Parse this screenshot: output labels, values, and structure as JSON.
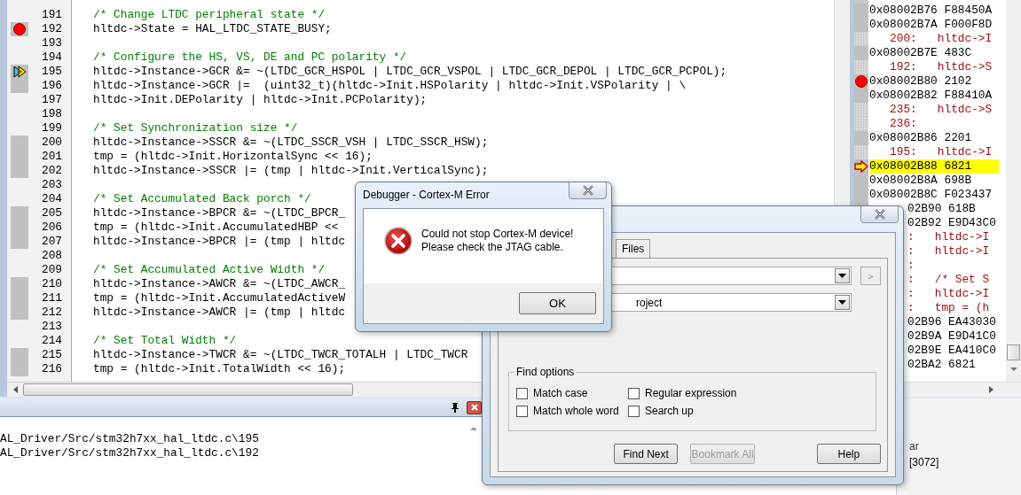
{
  "editor": {
    "lines": [
      {
        "number": "191",
        "text": "/* Change LTDC peripheral state */",
        "kind": "comment",
        "executable": false,
        "breakpoint": false,
        "current": false
      },
      {
        "number": "192",
        "text": "hltdc->State = HAL_LTDC_STATE_BUSY;",
        "kind": "code",
        "executable": true,
        "breakpoint": true,
        "current": false
      },
      {
        "number": "193",
        "kind": "blank",
        "executable": false,
        "breakpoint": false,
        "current": false
      },
      {
        "number": "194",
        "text": "/* Configure the HS, VS, DE and PC polarity */",
        "kind": "comment",
        "executable": false,
        "breakpoint": false,
        "current": false
      },
      {
        "number": "195",
        "text": "hltdc->Instance->GCR &= ~(LTDC_GCR_HSPOL | LTDC_GCR_VSPOL | LTDC_GCR_DEPOL | LTDC_GCR_PCPOL);",
        "kind": "code",
        "executable": true,
        "breakpoint": false,
        "current": true
      },
      {
        "number": "196",
        "text": "hltdc->Instance->GCR |=  (uint32_t)(hltdc->Init.HSPolarity | hltdc->Init.VSPolarity | \\",
        "kind": "code",
        "executable": true,
        "breakpoint": false,
        "current": false
      },
      {
        "number": "197",
        "text": "hltdc->Init.DEPolarity | hltdc->Init.PCPolarity);",
        "kind": "code",
        "executable": false,
        "breakpoint": false,
        "current": false
      },
      {
        "number": "198",
        "kind": "blank",
        "executable": false,
        "breakpoint": false,
        "current": false
      },
      {
        "number": "199",
        "text": "/* Set Synchronization size */",
        "kind": "comment",
        "executable": false,
        "breakpoint": false,
        "current": false
      },
      {
        "number": "200",
        "text": "hltdc->Instance->SSCR &= ~(LTDC_SSCR_VSH | LTDC_SSCR_HSW);",
        "kind": "code",
        "executable": true,
        "breakpoint": false,
        "current": false
      },
      {
        "number": "201",
        "text": "tmp = (hltdc->Init.HorizontalSync << 16);",
        "kind": "code",
        "executable": true,
        "breakpoint": false,
        "current": false
      },
      {
        "number": "202",
        "text": "hltdc->Instance->SSCR |= (tmp | hltdc->Init.VerticalSync);",
        "kind": "code",
        "executable": true,
        "breakpoint": false,
        "current": false
      },
      {
        "number": "203",
        "kind": "blank",
        "executable": false,
        "breakpoint": false,
        "current": false
      },
      {
        "number": "204",
        "text": "/* Set Accumulated Back porch */",
        "kind": "comment",
        "executable": false,
        "breakpoint": false,
        "current": false
      },
      {
        "number": "205",
        "text": "hltdc->Instance->BPCR &= ~(LTDC_BPCR_",
        "kind": "code",
        "executable": true,
        "breakpoint": false,
        "current": false
      },
      {
        "number": "206",
        "text": "tmp = (hltdc->Init.AccumulatedHBP <<",
        "kind": "code",
        "executable": true,
        "breakpoint": false,
        "current": false
      },
      {
        "number": "207",
        "text": "hltdc->Instance->BPCR |= (tmp | hltdc",
        "kind": "code",
        "executable": true,
        "breakpoint": false,
        "current": false
      },
      {
        "number": "208",
        "kind": "blank",
        "executable": false,
        "breakpoint": false,
        "current": false
      },
      {
        "number": "209",
        "text": "/* Set Accumulated Active Width */",
        "kind": "comment",
        "executable": false,
        "breakpoint": false,
        "current": false
      },
      {
        "number": "210",
        "text": "hltdc->Instance->AWCR &= ~(LTDC_AWCR_",
        "kind": "code",
        "executable": true,
        "breakpoint": false,
        "current": false
      },
      {
        "number": "211",
        "text": "tmp = (hltdc->Init.AccumulatedActiveW",
        "kind": "code",
        "executable": true,
        "breakpoint": false,
        "current": false
      },
      {
        "number": "212",
        "text": "hltdc->Instance->AWCR |= (tmp | hltdc",
        "kind": "code",
        "executable": true,
        "breakpoint": false,
        "current": false
      },
      {
        "number": "213",
        "kind": "blank",
        "executable": false,
        "breakpoint": false,
        "current": false
      },
      {
        "number": "214",
        "text": "/* Set Total Width */",
        "kind": "comment",
        "executable": false,
        "breakpoint": false,
        "current": false
      },
      {
        "number": "215",
        "text": "hltdc->Instance->TWCR &= ~(LTDC_TWCR_TOTALH | LTDC_TWCR",
        "kind": "code",
        "executable": true,
        "breakpoint": false,
        "current": false
      },
      {
        "number": "216",
        "text": "tmp = (hltdc->Init.TotalWidth << 16);",
        "kind": "code",
        "executable": true,
        "breakpoint": false,
        "current": false
      }
    ]
  },
  "disassembly": {
    "rows": [
      {
        "text": "0x08002B76 F88450A",
        "kind": "addr",
        "partly_covered": false,
        "breakpoint": false,
        "current": false
      },
      {
        "text": "0x08002B7A F000F8D",
        "kind": "addr",
        "partly_covered": false,
        "breakpoint": false,
        "current": false
      },
      {
        "text": "   200:   hltdc->I",
        "kind": "src",
        "partly_covered": false,
        "breakpoint": false,
        "current": false
      },
      {
        "text": "0x08002B7E 483C",
        "kind": "addr",
        "partly_covered": false,
        "breakpoint": false,
        "current": false
      },
      {
        "text": "   192:   hltdc->S",
        "kind": "src",
        "partly_covered": false,
        "breakpoint": false,
        "current": false
      },
      {
        "text": "0x08002B80 2102",
        "kind": "addr",
        "partly_covered": false,
        "breakpoint": true,
        "current": false
      },
      {
        "text": "0x08002B82 F88410A",
        "kind": "addr",
        "partly_covered": false,
        "breakpoint": false,
        "current": false
      },
      {
        "text": "   235:   hltdc->S",
        "kind": "src",
        "partly_covered": false,
        "breakpoint": false,
        "current": false
      },
      {
        "text": "   236:",
        "kind": "src",
        "partly_covered": false,
        "breakpoint": false,
        "current": false
      },
      {
        "text": "0x08002B86 2201",
        "kind": "addr",
        "partly_covered": false,
        "breakpoint": false,
        "current": false
      },
      {
        "text": "   195:   hltdc->I",
        "kind": "src",
        "partly_covered": false,
        "breakpoint": false,
        "current": false
      },
      {
        "text": "0x08002B88 6821",
        "kind": "addr",
        "partly_covered": false,
        "breakpoint": false,
        "current": true
      },
      {
        "text": "0x08002B8A 698B",
        "kind": "addr",
        "partly_covered": false,
        "breakpoint": false,
        "current": false
      },
      {
        "text": "0x08002B8C F023437",
        "kind": "addr",
        "partly_covered": false,
        "breakpoint": false,
        "current": false
      },
      {
        "text": "02B90 618B",
        "kind": "addr",
        "partly_covered": true,
        "breakpoint": false,
        "current": false
      },
      {
        "text": "02B92 E9D43C0",
        "kind": "addr",
        "partly_covered": true,
        "breakpoint": false,
        "current": false
      },
      {
        "text": ":   hltdc->I",
        "kind": "src",
        "partly_covered": true,
        "breakpoint": false,
        "current": false
      },
      {
        "text": ":   hltdc->I",
        "kind": "src",
        "partly_covered": true,
        "breakpoint": false,
        "current": false
      },
      {
        "text": ":",
        "kind": "src",
        "partly_covered": true,
        "breakpoint": false,
        "current": false
      },
      {
        "text": ":   /* Set S",
        "kind": "src",
        "partly_covered": true,
        "breakpoint": false,
        "current": false
      },
      {
        "text": ":   hltdc->I",
        "kind": "src",
        "partly_covered": true,
        "breakpoint": false,
        "current": false
      },
      {
        "text": ":   tmp = (h",
        "kind": "src",
        "partly_covered": true,
        "breakpoint": false,
        "current": false
      },
      {
        "text": "02B96 EA43030",
        "kind": "addr",
        "partly_covered": true,
        "breakpoint": false,
        "current": false
      },
      {
        "text": "02B9A E9D41C0",
        "kind": "addr",
        "partly_covered": true,
        "breakpoint": false,
        "current": false
      },
      {
        "text": "02B9E EA410C0",
        "kind": "addr",
        "partly_covered": true,
        "breakpoint": false,
        "current": false
      },
      {
        "text": "02BA2 6821",
        "kind": "addr",
        "partly_covered": true,
        "breakpoint": false,
        "current": false
      }
    ]
  },
  "output": {
    "lines": [
      "AL_Driver/Src/stm32h7xx_hal_ltdc.c\\195",
      "AL_Driver/Src/stm32h7xx_hal_ltdc.c\\192"
    ]
  },
  "side_panel": {
    "header": "ar",
    "cell": "[3072]"
  },
  "find_dialog": {
    "tabs": [
      {
        "label": "Files",
        "selected": false
      }
    ],
    "fields": [
      {
        "button_label": ">"
      },
      {
        "value": "roject"
      }
    ],
    "find_options": {
      "title": "Find options",
      "options": [
        {
          "label": "Match case",
          "checked": false
        },
        {
          "label": "Regular expression",
          "checked": false
        },
        {
          "label": "Match whole word",
          "checked": false
        },
        {
          "label": "Search up",
          "checked": false
        }
      ]
    },
    "buttons": [
      {
        "label": "Find Next",
        "disabled": false
      },
      {
        "label": "Bookmark All",
        "disabled": true
      },
      {
        "label": "Help",
        "disabled": false
      }
    ]
  },
  "error_dialog": {
    "title": "Debugger - Cortex-M Error",
    "message": "Could not stop Cortex-M device!\nPlease check the JTAG cable.",
    "button": "OK"
  }
}
